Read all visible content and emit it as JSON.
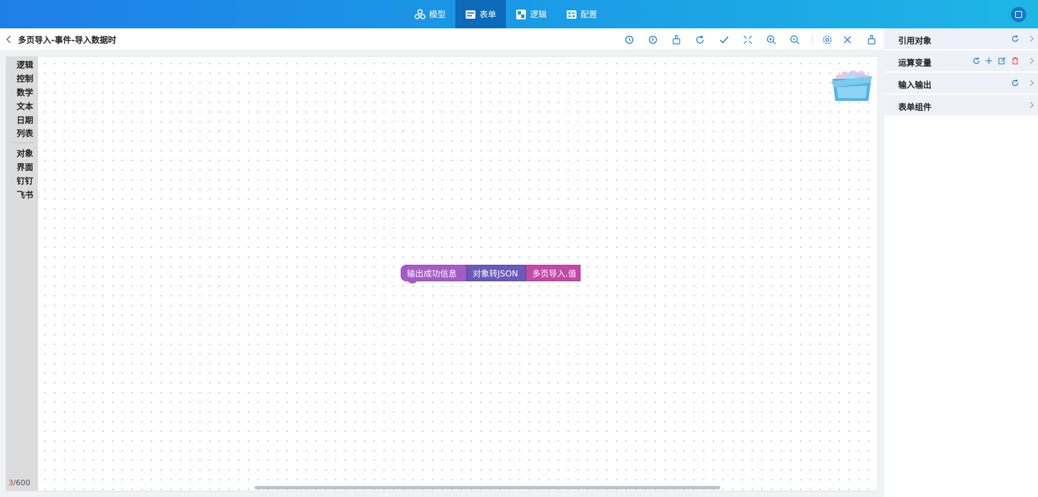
{
  "top_nav": {
    "tabs": [
      {
        "label": "模型",
        "icon": "model-icon",
        "active": false
      },
      {
        "label": "表单",
        "icon": "form-icon",
        "active": true
      },
      {
        "label": "逻辑",
        "icon": "logic-icon",
        "active": false
      },
      {
        "label": "配置",
        "icon": "config-icon",
        "active": false
      }
    ],
    "accent_color": "#1a9ae6",
    "active_color": "#0d6ab8"
  },
  "title_bar": {
    "title": "多页导入-事件-导入数据时",
    "toolbar_icons": [
      "undo-history-icon",
      "redo-history-icon",
      "clean-icon",
      "refresh-icon",
      "check-icon",
      "collapse-icon",
      "zoom-in-icon",
      "zoom-out-icon",
      "settings-icon",
      "close-icon",
      "broom-icon"
    ]
  },
  "categories": {
    "group1": [
      "逻辑",
      "控制",
      "数学",
      "文本",
      "日期",
      "列表"
    ],
    "group2": [
      "对象",
      "界面",
      "钉钉",
      "飞书"
    ]
  },
  "blocks": {
    "output": "输出成功信息",
    "to_json": "对象转JSON",
    "value": "多页导入.值"
  },
  "counter": {
    "current": "3",
    "total": "/600"
  },
  "right_panel": {
    "rows": [
      {
        "label": "引用对象",
        "actions": [
          "refresh-icon"
        ]
      },
      {
        "label": "运算变量",
        "actions": [
          "refresh-icon",
          "plus-icon",
          "edit-icon",
          "delete-icon"
        ]
      },
      {
        "label": "输入输出",
        "actions": [
          "refresh-icon"
        ]
      },
      {
        "label": "表单组件",
        "actions": []
      }
    ]
  }
}
